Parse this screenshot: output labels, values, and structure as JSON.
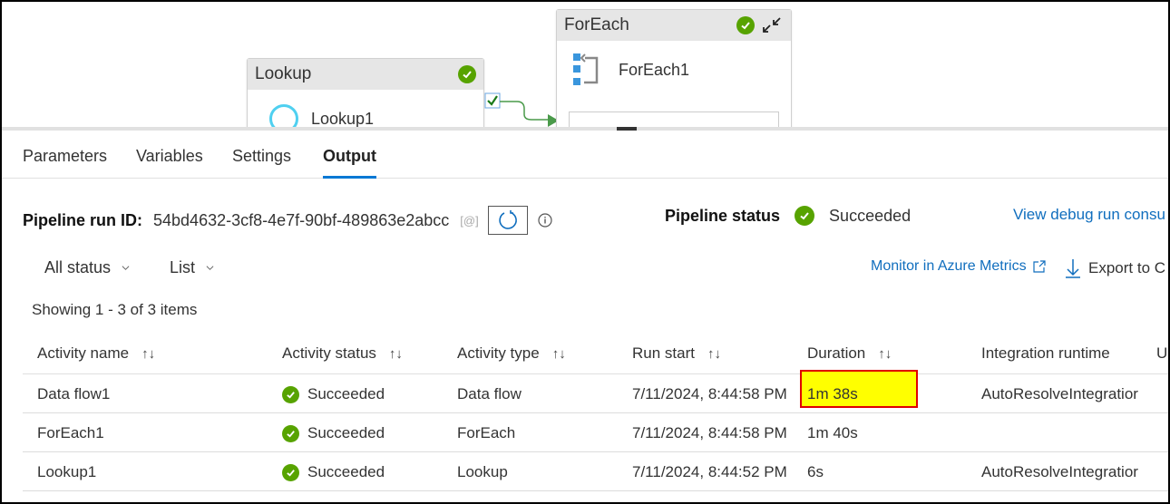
{
  "canvas": {
    "lookup_node": {
      "header": "Lookup",
      "activity_name": "Lookup1",
      "status": "succeeded"
    },
    "foreach_node": {
      "header": "ForEach",
      "activity_name": "ForEach1",
      "status": "succeeded"
    },
    "connector_status": "success"
  },
  "tabs": [
    {
      "label": "Parameters",
      "active": false
    },
    {
      "label": "Variables",
      "active": false
    },
    {
      "label": "Settings",
      "active": false
    },
    {
      "label": "Output",
      "active": true
    }
  ],
  "run_info": {
    "run_id_label": "Pipeline run ID:",
    "run_id": "54bd4632-3cf8-4e7f-90bf-489863e2abcc",
    "copy_icon_text": "[@]",
    "status_label": "Pipeline status",
    "status_value": "Succeeded",
    "view_debug_link": "View debug run consu"
  },
  "filters": {
    "status_dropdown": "All status",
    "view_dropdown": "List"
  },
  "actions": {
    "monitor_link": "Monitor in Azure Metrics",
    "export_label": "Export to C"
  },
  "showing_text": "Showing 1 - 3 of 3 items",
  "table": {
    "columns": [
      "Activity name",
      "Activity status",
      "Activity type",
      "Run start",
      "Duration",
      "Integration runtime",
      "U"
    ],
    "sort_glyph": "↑↓",
    "rows": [
      {
        "name": "Data flow1",
        "status": "Succeeded",
        "type": "Data flow",
        "run_start": "7/11/2024, 8:44:58 PM",
        "duration": "1m 38s",
        "runtime": "AutoResolveIntegratior",
        "highlighted": true
      },
      {
        "name": "ForEach1",
        "status": "Succeeded",
        "type": "ForEach",
        "run_start": "7/11/2024, 8:44:58 PM",
        "duration": "1m 40s",
        "runtime": "",
        "highlighted": false
      },
      {
        "name": "Lookup1",
        "status": "Succeeded",
        "type": "Lookup",
        "run_start": "7/11/2024, 8:44:52 PM",
        "duration": "6s",
        "runtime": "AutoResolveIntegratior",
        "highlighted": false
      }
    ]
  },
  "colors": {
    "success": "#57a300",
    "accent": "#0078d4",
    "link": "#106ebe",
    "highlight_fill": "#ffff00",
    "highlight_border": "#e00000"
  }
}
